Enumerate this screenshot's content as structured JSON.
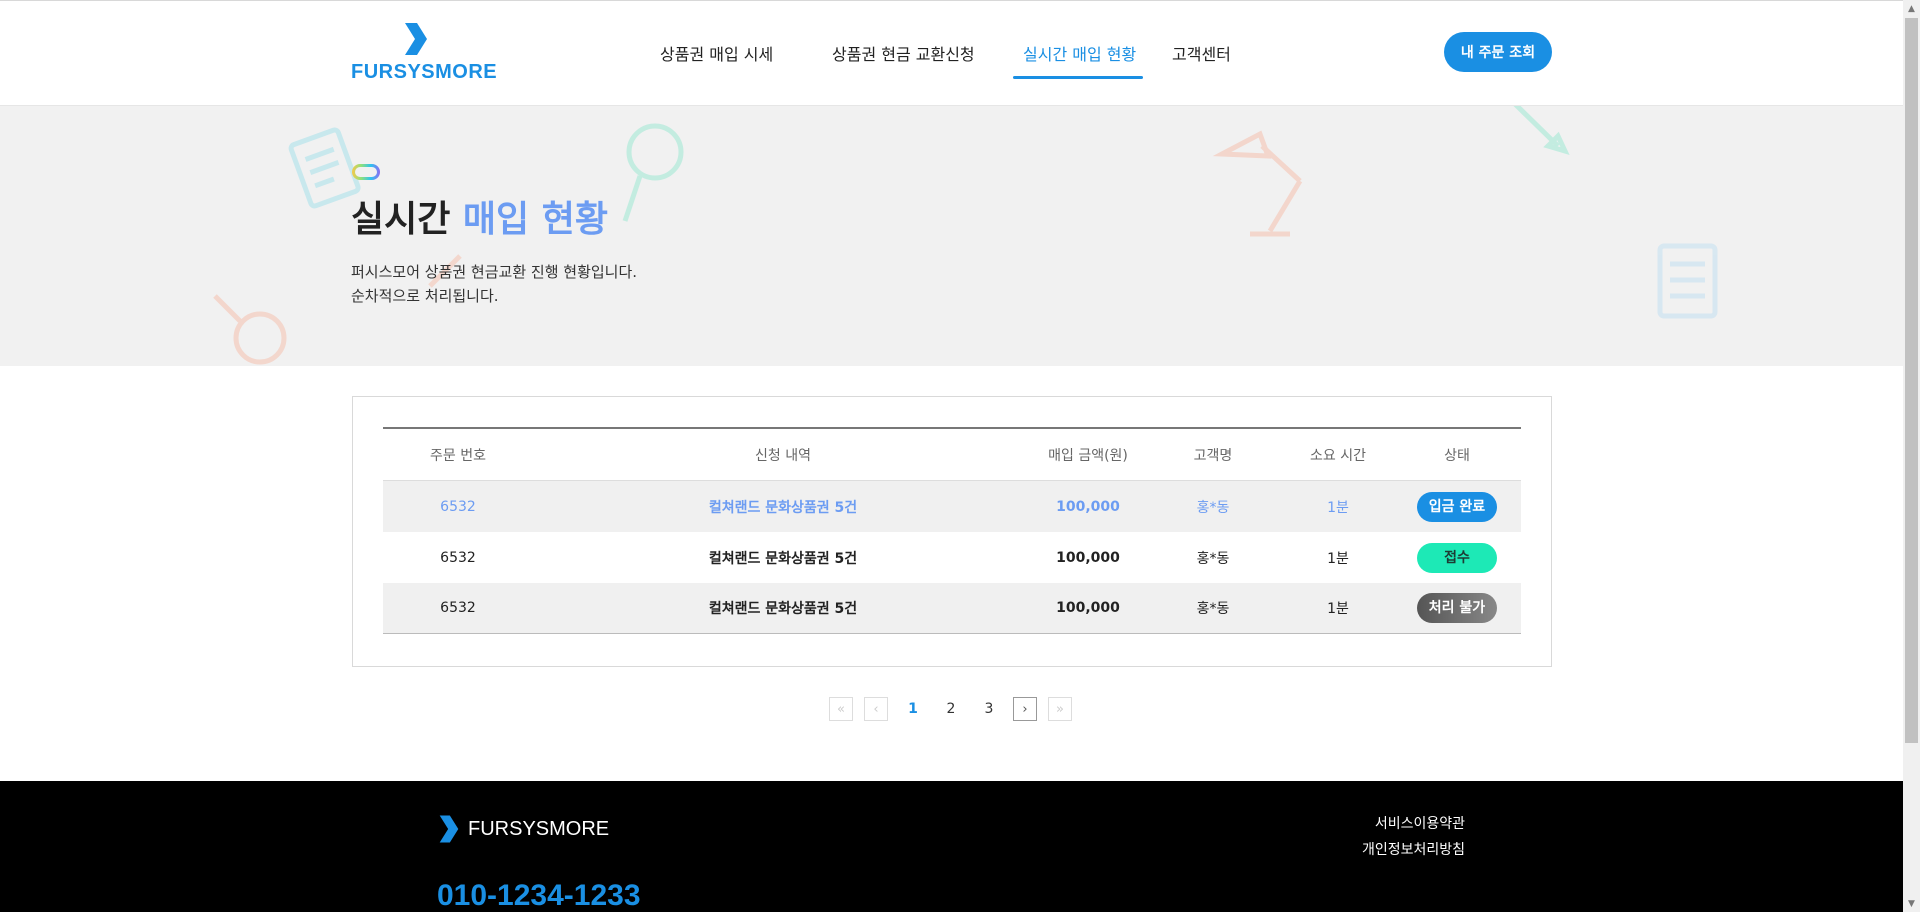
{
  "header": {
    "logo_text": "FURSYSMORE",
    "nav": [
      "상품권 매입 시세",
      "상품권 현금 교환신청",
      "실시간 매입 현황",
      "고객센터"
    ],
    "order_button": "내 주문 조회"
  },
  "hero": {
    "title_main": "실시간",
    "title_accent": "매입 현황",
    "desc_line1": "퍼시스모어 상품권 현금교환 진행 현황입니다.",
    "desc_line2": "순차적으로 처리됩니다."
  },
  "table": {
    "headers": [
      "주문 번호",
      "신청 내역",
      "매입 금액(원)",
      "고객명",
      "소요 시간",
      "상태"
    ],
    "rows": [
      {
        "order": "6532",
        "item": "컬쳐랜드 문화상품권 5건",
        "amount": "100,000",
        "name": "홍*동",
        "time": "1분",
        "status": "입금 완료"
      },
      {
        "order": "6532",
        "item": "컬쳐랜드 문화상품권 5건",
        "amount": "100,000",
        "name": "홍*동",
        "time": "1분",
        "status": "접수"
      },
      {
        "order": "6532",
        "item": "컬쳐랜드 문화상품권 5건",
        "amount": "100,000",
        "name": "홍*동",
        "time": "1분",
        "status": "처리 불가"
      }
    ]
  },
  "pagination": {
    "first": "«",
    "prev": "‹",
    "next": "›",
    "last": "»",
    "pages": [
      "1",
      "2",
      "3"
    ],
    "current": "1"
  },
  "footer": {
    "logo_text": "FURSYSMORE",
    "phone": "010-1234-1233",
    "links": [
      "서비스이용약관",
      "개인정보처리방침"
    ]
  },
  "colors": {
    "brand": "#1a8fe3",
    "accent": "#6c9cf2",
    "status_done": "#1a8fe3",
    "status_received": "#1de9b6",
    "status_failed": "#6e6e6e"
  }
}
